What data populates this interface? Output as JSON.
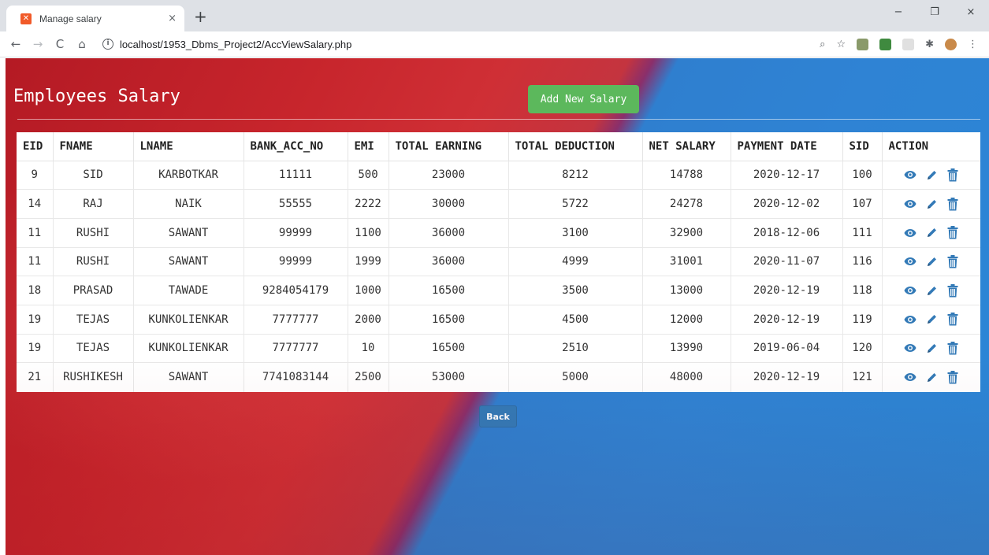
{
  "browser": {
    "tab_title": "Manage salary",
    "tab_close": "×",
    "new_tab": "+",
    "url": "localhost/1953_Dbms_Project2/AccViewSalary.php",
    "nav": {
      "back": "←",
      "forward": "→",
      "reload": "C",
      "home": "⌂"
    },
    "window_controls": {
      "minimize": "−",
      "restore": "❐",
      "close": "×"
    }
  },
  "page": {
    "title": "Employees Salary",
    "add_button": "Add New Salary",
    "back_button": "Back"
  },
  "table": {
    "headers": [
      "EID",
      "FNAME",
      "LNAME",
      "BANK_ACC_NO",
      "EMI",
      "TOTAL EARNING",
      "TOTAL DEDUCTION",
      "NET SALARY",
      "PAYMENT DATE",
      "SID",
      "ACTION"
    ],
    "rows": [
      [
        "9",
        "SID",
        "KARBOTKAR",
        "11111",
        "500",
        "23000",
        "8212",
        "14788",
        "2020-12-17",
        "100"
      ],
      [
        "14",
        "RAJ",
        "NAIK",
        "55555",
        "2222",
        "30000",
        "5722",
        "24278",
        "2020-12-02",
        "107"
      ],
      [
        "11",
        "RUSHI",
        "SAWANT",
        "99999",
        "1100",
        "36000",
        "3100",
        "32900",
        "2018-12-06",
        "111"
      ],
      [
        "11",
        "RUSHI",
        "SAWANT",
        "99999",
        "1999",
        "36000",
        "4999",
        "31001",
        "2020-11-07",
        "116"
      ],
      [
        "18",
        "PRASAD",
        "TAWADE",
        "9284054179",
        "1000",
        "16500",
        "3500",
        "13000",
        "2020-12-19",
        "118"
      ],
      [
        "19",
        "TEJAS",
        "KUNKOLIENKAR",
        "7777777",
        "2000",
        "16500",
        "4500",
        "12000",
        "2020-12-19",
        "119"
      ],
      [
        "19",
        "TEJAS",
        "KUNKOLIENKAR",
        "7777777",
        "10",
        "16500",
        "2510",
        "13990",
        "2019-06-04",
        "120"
      ],
      [
        "21",
        "RUSHIKESH",
        "SAWANT",
        "7741083144",
        "2500",
        "53000",
        "5000",
        "48000",
        "2020-12-19",
        "121"
      ]
    ],
    "action_icons": [
      "eye-icon",
      "pencil-icon",
      "trash-icon"
    ],
    "icon_color": "#337ab7"
  },
  "colors": {
    "add_button": "#5cb85c",
    "back_button": "#337ab7",
    "background_red": "#c7252c",
    "background_blue": "#2f83d4"
  }
}
